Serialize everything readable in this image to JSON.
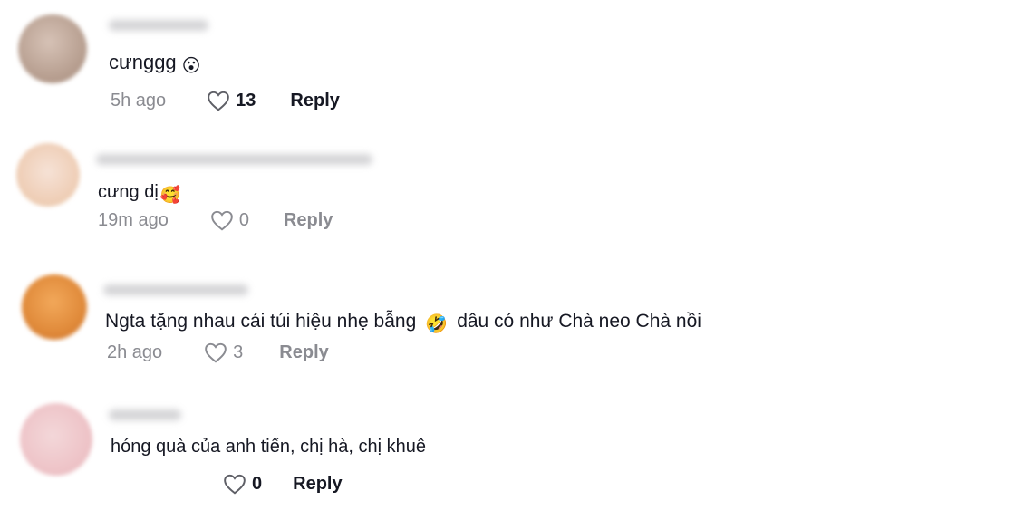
{
  "comments": [
    {
      "text": "cưnggg",
      "emoji": "😮",
      "time": "5h ago",
      "likes": "13",
      "reply": "Reply"
    },
    {
      "text": "cưng dị",
      "emoji": "🥰",
      "time": "19m ago",
      "likes": "0",
      "reply": "Reply"
    },
    {
      "text": "Ngta tặng nhau cái túi hiệu nhẹ bẫng",
      "emoji": "🤣",
      "text2": "dâu có như Chà neo Chà nồi",
      "time": "2h ago",
      "likes": "3",
      "reply": "Reply"
    },
    {
      "text": "hóng quà của anh tiến, chị hà, chị khuê",
      "time": "",
      "likes": "0",
      "reply": "Reply"
    }
  ],
  "colors": {
    "text": "#161823",
    "muted": "#8a8b91",
    "background": "#ffffff"
  },
  "icons": {
    "like": "heart-outline-icon"
  }
}
